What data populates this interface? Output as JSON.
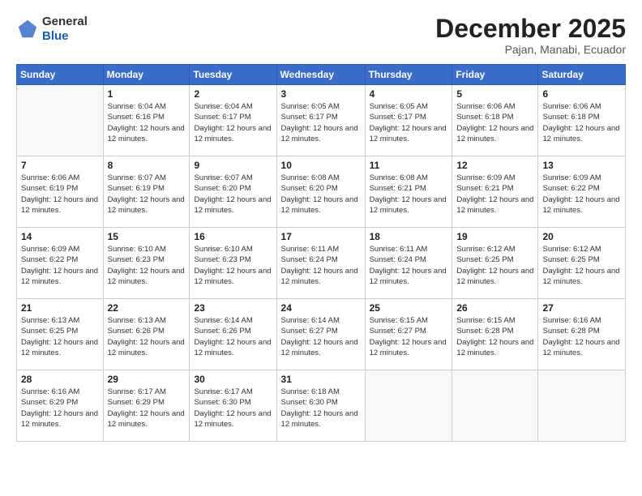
{
  "header": {
    "logo_general": "General",
    "logo_blue": "Blue",
    "month_title": "December 2025",
    "subtitle": "Pajan, Manabi, Ecuador"
  },
  "days_of_week": [
    "Sunday",
    "Monday",
    "Tuesday",
    "Wednesday",
    "Thursday",
    "Friday",
    "Saturday"
  ],
  "weeks": [
    [
      {
        "num": "",
        "sunrise": "",
        "sunset": "",
        "daylight": ""
      },
      {
        "num": "1",
        "sunrise": "Sunrise: 6:04 AM",
        "sunset": "Sunset: 6:16 PM",
        "daylight": "Daylight: 12 hours and 12 minutes."
      },
      {
        "num": "2",
        "sunrise": "Sunrise: 6:04 AM",
        "sunset": "Sunset: 6:17 PM",
        "daylight": "Daylight: 12 hours and 12 minutes."
      },
      {
        "num": "3",
        "sunrise": "Sunrise: 6:05 AM",
        "sunset": "Sunset: 6:17 PM",
        "daylight": "Daylight: 12 hours and 12 minutes."
      },
      {
        "num": "4",
        "sunrise": "Sunrise: 6:05 AM",
        "sunset": "Sunset: 6:17 PM",
        "daylight": "Daylight: 12 hours and 12 minutes."
      },
      {
        "num": "5",
        "sunrise": "Sunrise: 6:06 AM",
        "sunset": "Sunset: 6:18 PM",
        "daylight": "Daylight: 12 hours and 12 minutes."
      },
      {
        "num": "6",
        "sunrise": "Sunrise: 6:06 AM",
        "sunset": "Sunset: 6:18 PM",
        "daylight": "Daylight: 12 hours and 12 minutes."
      }
    ],
    [
      {
        "num": "7",
        "sunrise": "Sunrise: 6:06 AM",
        "sunset": "Sunset: 6:19 PM",
        "daylight": "Daylight: 12 hours and 12 minutes."
      },
      {
        "num": "8",
        "sunrise": "Sunrise: 6:07 AM",
        "sunset": "Sunset: 6:19 PM",
        "daylight": "Daylight: 12 hours and 12 minutes."
      },
      {
        "num": "9",
        "sunrise": "Sunrise: 6:07 AM",
        "sunset": "Sunset: 6:20 PM",
        "daylight": "Daylight: 12 hours and 12 minutes."
      },
      {
        "num": "10",
        "sunrise": "Sunrise: 6:08 AM",
        "sunset": "Sunset: 6:20 PM",
        "daylight": "Daylight: 12 hours and 12 minutes."
      },
      {
        "num": "11",
        "sunrise": "Sunrise: 6:08 AM",
        "sunset": "Sunset: 6:21 PM",
        "daylight": "Daylight: 12 hours and 12 minutes."
      },
      {
        "num": "12",
        "sunrise": "Sunrise: 6:09 AM",
        "sunset": "Sunset: 6:21 PM",
        "daylight": "Daylight: 12 hours and 12 minutes."
      },
      {
        "num": "13",
        "sunrise": "Sunrise: 6:09 AM",
        "sunset": "Sunset: 6:22 PM",
        "daylight": "Daylight: 12 hours and 12 minutes."
      }
    ],
    [
      {
        "num": "14",
        "sunrise": "Sunrise: 6:09 AM",
        "sunset": "Sunset: 6:22 PM",
        "daylight": "Daylight: 12 hours and 12 minutes."
      },
      {
        "num": "15",
        "sunrise": "Sunrise: 6:10 AM",
        "sunset": "Sunset: 6:23 PM",
        "daylight": "Daylight: 12 hours and 12 minutes."
      },
      {
        "num": "16",
        "sunrise": "Sunrise: 6:10 AM",
        "sunset": "Sunset: 6:23 PM",
        "daylight": "Daylight: 12 hours and 12 minutes."
      },
      {
        "num": "17",
        "sunrise": "Sunrise: 6:11 AM",
        "sunset": "Sunset: 6:24 PM",
        "daylight": "Daylight: 12 hours and 12 minutes."
      },
      {
        "num": "18",
        "sunrise": "Sunrise: 6:11 AM",
        "sunset": "Sunset: 6:24 PM",
        "daylight": "Daylight: 12 hours and 12 minutes."
      },
      {
        "num": "19",
        "sunrise": "Sunrise: 6:12 AM",
        "sunset": "Sunset: 6:25 PM",
        "daylight": "Daylight: 12 hours and 12 minutes."
      },
      {
        "num": "20",
        "sunrise": "Sunrise: 6:12 AM",
        "sunset": "Sunset: 6:25 PM",
        "daylight": "Daylight: 12 hours and 12 minutes."
      }
    ],
    [
      {
        "num": "21",
        "sunrise": "Sunrise: 6:13 AM",
        "sunset": "Sunset: 6:25 PM",
        "daylight": "Daylight: 12 hours and 12 minutes."
      },
      {
        "num": "22",
        "sunrise": "Sunrise: 6:13 AM",
        "sunset": "Sunset: 6:26 PM",
        "daylight": "Daylight: 12 hours and 12 minutes."
      },
      {
        "num": "23",
        "sunrise": "Sunrise: 6:14 AM",
        "sunset": "Sunset: 6:26 PM",
        "daylight": "Daylight: 12 hours and 12 minutes."
      },
      {
        "num": "24",
        "sunrise": "Sunrise: 6:14 AM",
        "sunset": "Sunset: 6:27 PM",
        "daylight": "Daylight: 12 hours and 12 minutes."
      },
      {
        "num": "25",
        "sunrise": "Sunrise: 6:15 AM",
        "sunset": "Sunset: 6:27 PM",
        "daylight": "Daylight: 12 hours and 12 minutes."
      },
      {
        "num": "26",
        "sunrise": "Sunrise: 6:15 AM",
        "sunset": "Sunset: 6:28 PM",
        "daylight": "Daylight: 12 hours and 12 minutes."
      },
      {
        "num": "27",
        "sunrise": "Sunrise: 6:16 AM",
        "sunset": "Sunset: 6:28 PM",
        "daylight": "Daylight: 12 hours and 12 minutes."
      }
    ],
    [
      {
        "num": "28",
        "sunrise": "Sunrise: 6:16 AM",
        "sunset": "Sunset: 6:29 PM",
        "daylight": "Daylight: 12 hours and 12 minutes."
      },
      {
        "num": "29",
        "sunrise": "Sunrise: 6:17 AM",
        "sunset": "Sunset: 6:29 PM",
        "daylight": "Daylight: 12 hours and 12 minutes."
      },
      {
        "num": "30",
        "sunrise": "Sunrise: 6:17 AM",
        "sunset": "Sunset: 6:30 PM",
        "daylight": "Daylight: 12 hours and 12 minutes."
      },
      {
        "num": "31",
        "sunrise": "Sunrise: 6:18 AM",
        "sunset": "Sunset: 6:30 PM",
        "daylight": "Daylight: 12 hours and 12 minutes."
      },
      {
        "num": "",
        "sunrise": "",
        "sunset": "",
        "daylight": ""
      },
      {
        "num": "",
        "sunrise": "",
        "sunset": "",
        "daylight": ""
      },
      {
        "num": "",
        "sunrise": "",
        "sunset": "",
        "daylight": ""
      }
    ]
  ]
}
